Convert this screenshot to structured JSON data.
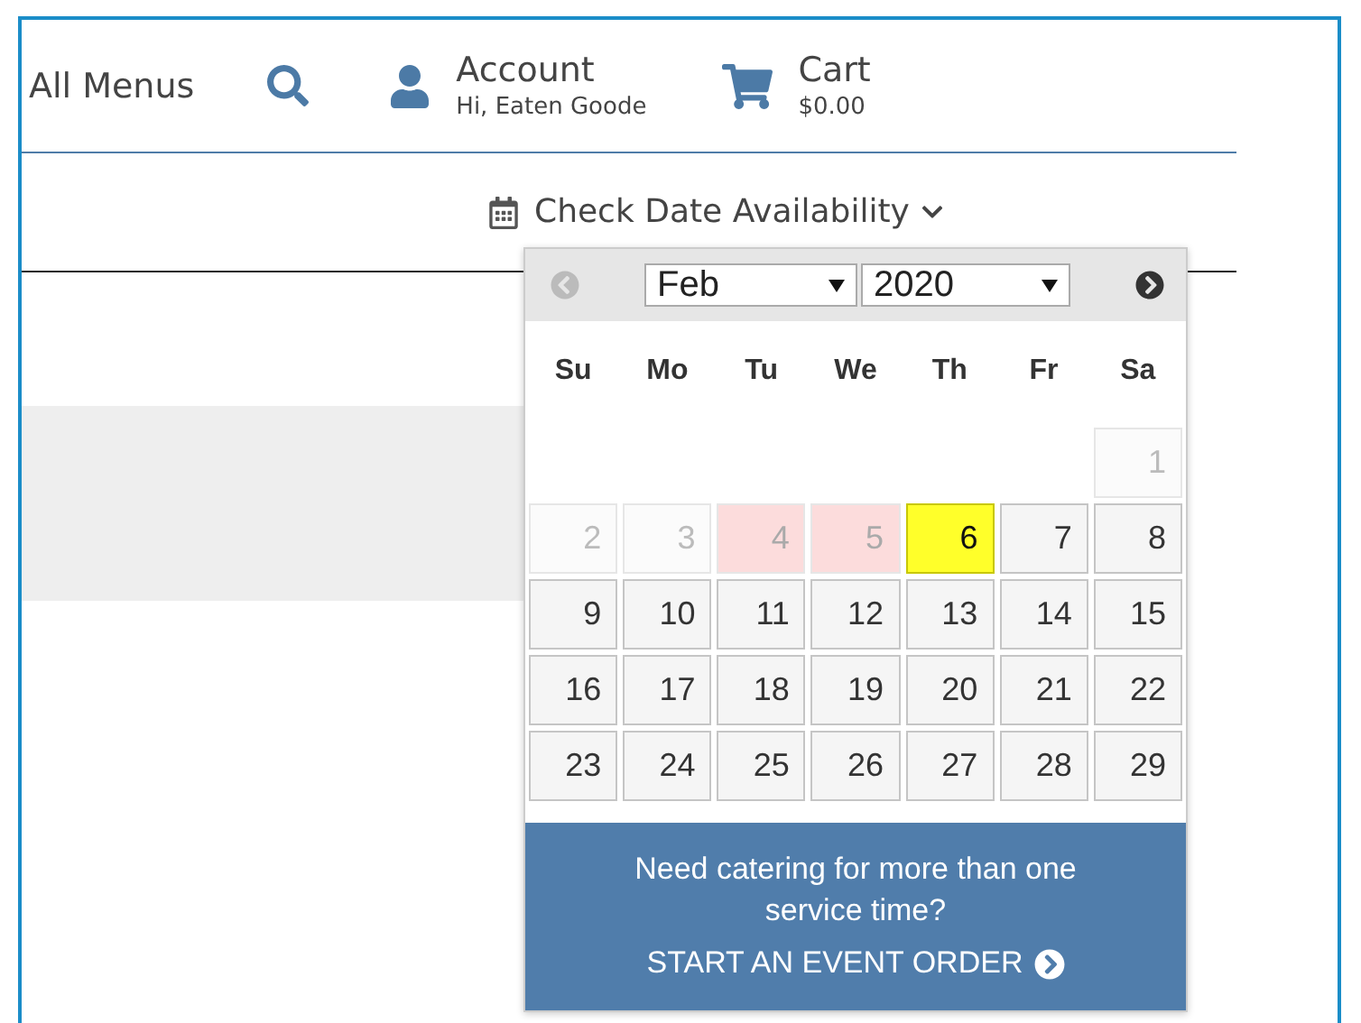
{
  "nav": {
    "menus_link": "All Menus",
    "account": {
      "title": "Account",
      "greeting": "Hi, Eaten Goode"
    },
    "cart": {
      "title": "Cart",
      "total": "$0.00"
    }
  },
  "date_toggle": {
    "label": "Check Date Availability",
    "expanded": true
  },
  "calendar": {
    "prev_disabled": true,
    "next_disabled": false,
    "month": "Feb",
    "year": "2020",
    "weekdays": [
      "Su",
      "Mo",
      "Tu",
      "We",
      "Th",
      "Fr",
      "Sa"
    ],
    "weeks": [
      [
        {
          "kind": "empty"
        },
        {
          "kind": "empty"
        },
        {
          "kind": "empty"
        },
        {
          "kind": "empty"
        },
        {
          "kind": "empty"
        },
        {
          "kind": "empty"
        },
        {
          "kind": "past",
          "day": "1",
          "selected": false
        }
      ],
      [
        {
          "kind": "past",
          "day": "2",
          "selected": false
        },
        {
          "kind": "past",
          "day": "3",
          "selected": false
        },
        {
          "kind": "blocked",
          "day": "4",
          "selected": false
        },
        {
          "kind": "blocked",
          "day": "5",
          "selected": false
        },
        {
          "kind": "available",
          "day": "6",
          "selected": true
        },
        {
          "kind": "available",
          "day": "7",
          "selected": false
        },
        {
          "kind": "available",
          "day": "8",
          "selected": false
        }
      ],
      [
        {
          "kind": "available",
          "day": "9",
          "selected": false
        },
        {
          "kind": "available",
          "day": "10",
          "selected": false
        },
        {
          "kind": "available",
          "day": "11",
          "selected": false
        },
        {
          "kind": "available",
          "day": "12",
          "selected": false
        },
        {
          "kind": "available",
          "day": "13",
          "selected": false
        },
        {
          "kind": "available",
          "day": "14",
          "selected": false
        },
        {
          "kind": "available",
          "day": "15",
          "selected": false
        }
      ],
      [
        {
          "kind": "available",
          "day": "16",
          "selected": false
        },
        {
          "kind": "available",
          "day": "17",
          "selected": false
        },
        {
          "kind": "available",
          "day": "18",
          "selected": false
        },
        {
          "kind": "available",
          "day": "19",
          "selected": false
        },
        {
          "kind": "available",
          "day": "20",
          "selected": false
        },
        {
          "kind": "available",
          "day": "21",
          "selected": false
        },
        {
          "kind": "available",
          "day": "22",
          "selected": false
        }
      ],
      [
        {
          "kind": "available",
          "day": "23",
          "selected": false
        },
        {
          "kind": "available",
          "day": "24",
          "selected": false
        },
        {
          "kind": "available",
          "day": "25",
          "selected": false
        },
        {
          "kind": "available",
          "day": "26",
          "selected": false
        },
        {
          "kind": "available",
          "day": "27",
          "selected": false
        },
        {
          "kind": "available",
          "day": "28",
          "selected": false
        },
        {
          "kind": "available",
          "day": "29",
          "selected": false
        }
      ]
    ],
    "footer": {
      "text": "Need catering for more than one service time?",
      "link": "START AN EVENT ORDER"
    }
  }
}
